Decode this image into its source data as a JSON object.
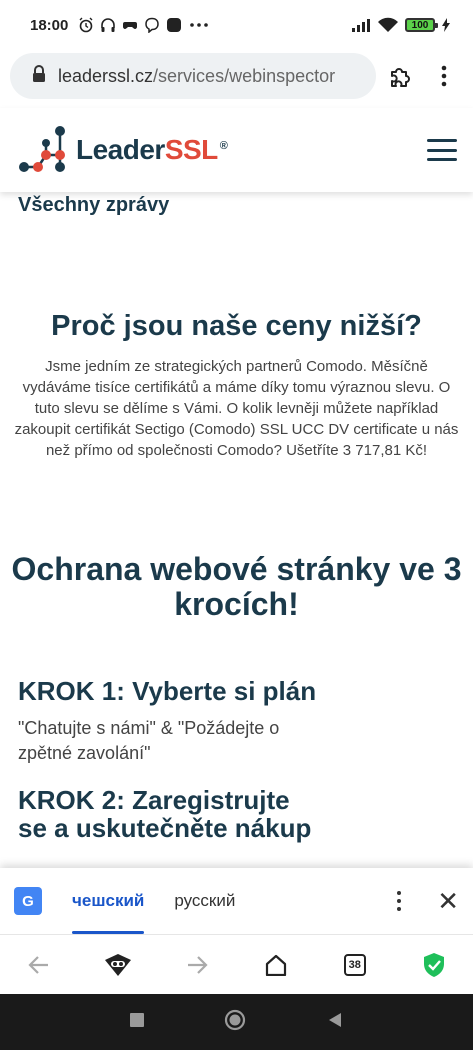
{
  "status_bar": {
    "time": "18:00",
    "battery": "100"
  },
  "browser": {
    "url_host": "leaderssl.cz",
    "url_path": "/services/webinspector"
  },
  "site": {
    "brand_main": "Leader",
    "brand_accent": "SSL",
    "brand_mark": "®"
  },
  "page": {
    "all_news": "Všechny zprávy",
    "why_title": "Proč jsou naše ceny nižší?",
    "why_text": "Jsme jedním ze strategických partnerů Comodo. Měsíčně vydáváme tisíce certifikátů a máme díky tomu výraznou slevu. O tuto slevu se dělíme s Vámi. O kolik levněji můžete například zakoupit certifikát Sectigo (Comodo) SSL UCC DV certificate u nás než přímo od společnosti Comodo? Ušetříte 3 717,81 Kč!",
    "protect_title": "Ochrana webové stránky ve 3 krocích!",
    "step1_title": "KROK 1: Vyberte si plán",
    "step1_text": "\"Chatujte s námi\" & \"Požádejte o zpětné zavolání\"",
    "step2_title": "KROK 2: Zaregistrujte se a uskutečněte nákup"
  },
  "translate_bar": {
    "lang_source": "чешский",
    "lang_target": "русский"
  },
  "toolbar": {
    "tab_count": "38"
  },
  "colors": {
    "brand_dark": "#1b3a4b",
    "brand_red": "#e04a3a",
    "link_blue": "#1a56c9",
    "shield_green": "#1fbf5a"
  },
  "icons": [
    "alarm-icon",
    "headphones-icon",
    "gamepad-icon",
    "viber-icon",
    "app-icon",
    "more-dots-icon",
    "signal-icon",
    "wifi-icon",
    "battery-icon",
    "charging-icon",
    "lock-icon",
    "extension-icon",
    "menu-icon",
    "hamburger-icon",
    "translate-icon",
    "close-icon",
    "back-arrow-icon",
    "incognito-icon",
    "forward-arrow-icon",
    "home-icon",
    "tabs-icon",
    "shield-icon",
    "nav-square-icon",
    "nav-circle-icon",
    "nav-triangle-icon"
  ]
}
